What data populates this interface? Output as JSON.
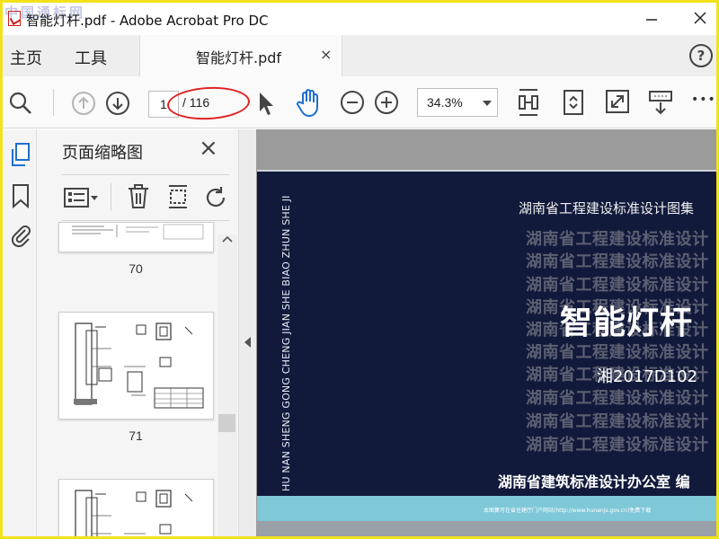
{
  "window": {
    "watermark": "中国通标网",
    "title": "智能灯杆.pdf - Adobe Acrobat Pro DC",
    "minimize_icon": "minimize-icon",
    "maximize_icon": "maximize-icon",
    "close_icon": "close-icon"
  },
  "tabs": {
    "home": "主页",
    "tools": "工具",
    "document": "智能灯杆.pdf",
    "document_close": "×",
    "help": "?"
  },
  "toolbar": {
    "current_page": "1",
    "total_pages": "/ 116",
    "zoom": "34.3%",
    "more": "•••",
    "annotation_color": "#e02020"
  },
  "thumbnail_panel": {
    "title": "页面缩略图",
    "close": "×",
    "thumbnails": [
      {
        "page": "70"
      },
      {
        "page": "71"
      }
    ]
  },
  "document": {
    "vertical_text": "HU NAN SHENG GONG CHENG JIAN SHE  BIAO ZHUN SHE JI",
    "series": "湖南省工程建设标准设计图集",
    "background_line": "湖南省工程建设标准设计",
    "title": "智能灯杆",
    "code": "湘2017D102",
    "publisher": "湖南省建筑标准设计办公室  编",
    "footer": "本图集可在省住建厅门户网站(http://www.hunanjs.gov.cn)免费下载",
    "colors": {
      "cover": "#121a3c",
      "strip": "#7fc8d8",
      "frame": "#f2e21b"
    }
  }
}
